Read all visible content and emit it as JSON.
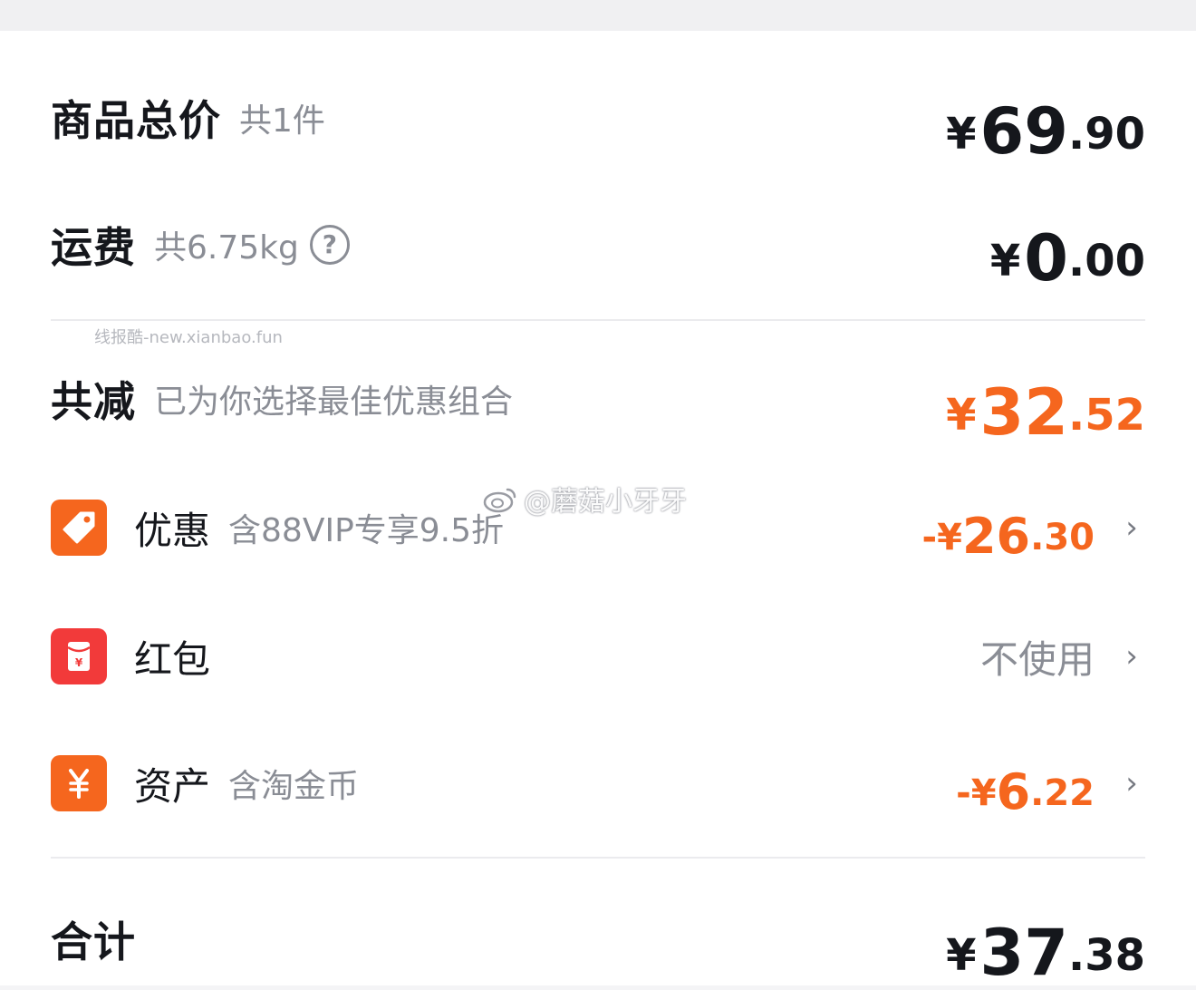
{
  "summary": {
    "goods_total": {
      "label": "商品总价",
      "sub": "共1件",
      "yen": "¥",
      "int": "69",
      "dec": ".90"
    },
    "shipping": {
      "label": "运费",
      "sub": "共6.75kg",
      "help_icon": "question-circle-icon",
      "help_glyph": "?",
      "yen": "¥",
      "int": "0",
      "dec": ".00"
    },
    "discount_total": {
      "label": "共减",
      "sub": "已为你选择最佳优惠组合",
      "yen": "¥",
      "int": "32",
      "dec": ".52"
    },
    "items": [
      {
        "icon": "tag-icon",
        "label": "优惠",
        "sub": "含88VIP专享9.5折",
        "prefix": "-¥",
        "int": "26",
        "dec": ".30"
      },
      {
        "icon": "red-envelope-icon",
        "label": "红包",
        "value_text": "不使用"
      },
      {
        "icon": "yen-coin-icon",
        "label": "资产",
        "sub": "含淘金币",
        "prefix": "-¥",
        "int": "6",
        "dec": ".22"
      }
    ],
    "grand_total": {
      "label": "合计",
      "yen": "¥",
      "int": "37",
      "dec": ".38"
    }
  },
  "chevron_glyph": "›",
  "watermarks": {
    "site": "线报酷-new.xianbao.fun",
    "weibo": "@蘑菇小牙牙"
  },
  "colors": {
    "accent_orange": "#f5661e",
    "red_envelope": "#f23a3a",
    "text_primary": "#15171c",
    "text_secondary": "#8a8d95"
  }
}
